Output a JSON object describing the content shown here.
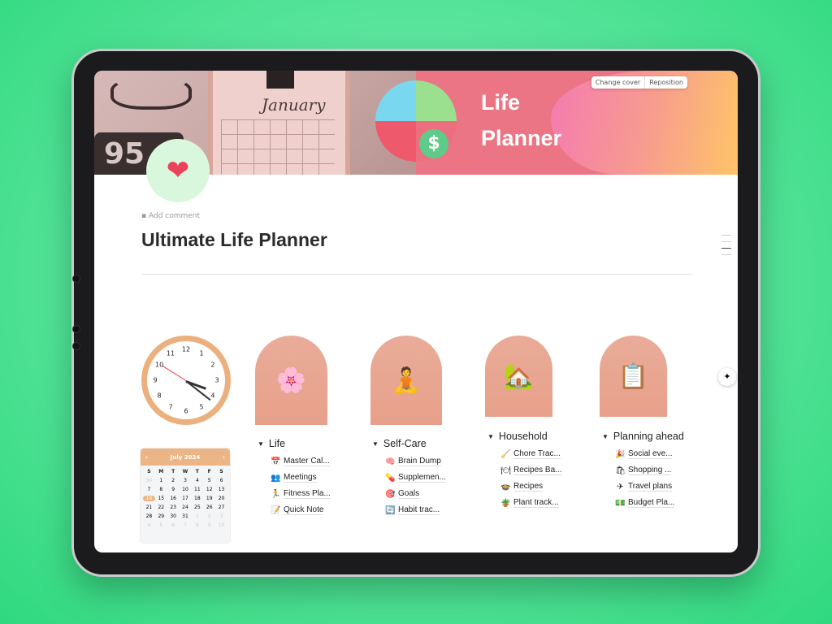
{
  "cover": {
    "title_line1": "Life",
    "title_line2": "Planner",
    "pad_title": "January",
    "digits": "95",
    "change_cover": "Change cover",
    "reposition": "Reposition"
  },
  "page": {
    "icon": "heart-hand-icon",
    "add_comment": "Add comment",
    "title": "Ultimate Life Planner"
  },
  "clock": {
    "numbers": [
      "12",
      "1",
      "2",
      "3",
      "4",
      "5",
      "6",
      "7",
      "8",
      "9",
      "10",
      "11"
    ]
  },
  "calendar": {
    "month": "July 2024",
    "prev": "‹",
    "next": "›",
    "dow": [
      "S",
      "M",
      "T",
      "W",
      "T",
      "F",
      "S"
    ],
    "weeks": [
      [
        "30",
        "1",
        "2",
        "3",
        "4",
        "5",
        "6"
      ],
      [
        "7",
        "8",
        "9",
        "10",
        "11",
        "12",
        "13"
      ],
      [
        "14",
        "15",
        "16",
        "17",
        "18",
        "19",
        "20"
      ],
      [
        "21",
        "22",
        "23",
        "24",
        "25",
        "26",
        "27"
      ],
      [
        "28",
        "29",
        "30",
        "31",
        "1",
        "2",
        "3"
      ],
      [
        "4",
        "5",
        "6",
        "7",
        "8",
        "9",
        "10"
      ]
    ],
    "selected": "14"
  },
  "sections": [
    {
      "title": "Life",
      "arch_icon": "🌸",
      "items": [
        {
          "icon": "📅",
          "label": "Master Cal..."
        },
        {
          "icon": "👥",
          "label": "Meetings"
        },
        {
          "icon": "🏃",
          "label": "Fitness Pla..."
        },
        {
          "icon": "📝",
          "label": "Quick Note"
        }
      ]
    },
    {
      "title": "Self-Care",
      "arch_icon": "🧘",
      "items": [
        {
          "icon": "🧠",
          "label": "Brain Dump"
        },
        {
          "icon": "💊",
          "label": "Supplemen..."
        },
        {
          "icon": "🎯",
          "label": "Goals"
        },
        {
          "icon": "🔄",
          "label": "Habit trac..."
        }
      ]
    },
    {
      "title": "Household",
      "arch_icon": "🏡",
      "items": [
        {
          "icon": "🧹",
          "label": "Chore Trac..."
        },
        {
          "icon": "🍽",
          "label": "Recipes Ba..."
        },
        {
          "icon": "🍲",
          "label": "Recipes"
        },
        {
          "icon": "🪴",
          "label": "Plant track..."
        }
      ]
    },
    {
      "title": "Planning ahead",
      "arch_icon": "📋",
      "items": [
        {
          "icon": "🎉",
          "label": "Social eve..."
        },
        {
          "icon": "🛍",
          "label": "Shopping ..."
        },
        {
          "icon": "✈",
          "label": "Travel plans"
        },
        {
          "icon": "💵",
          "label": "Budget Pla..."
        }
      ]
    }
  ]
}
